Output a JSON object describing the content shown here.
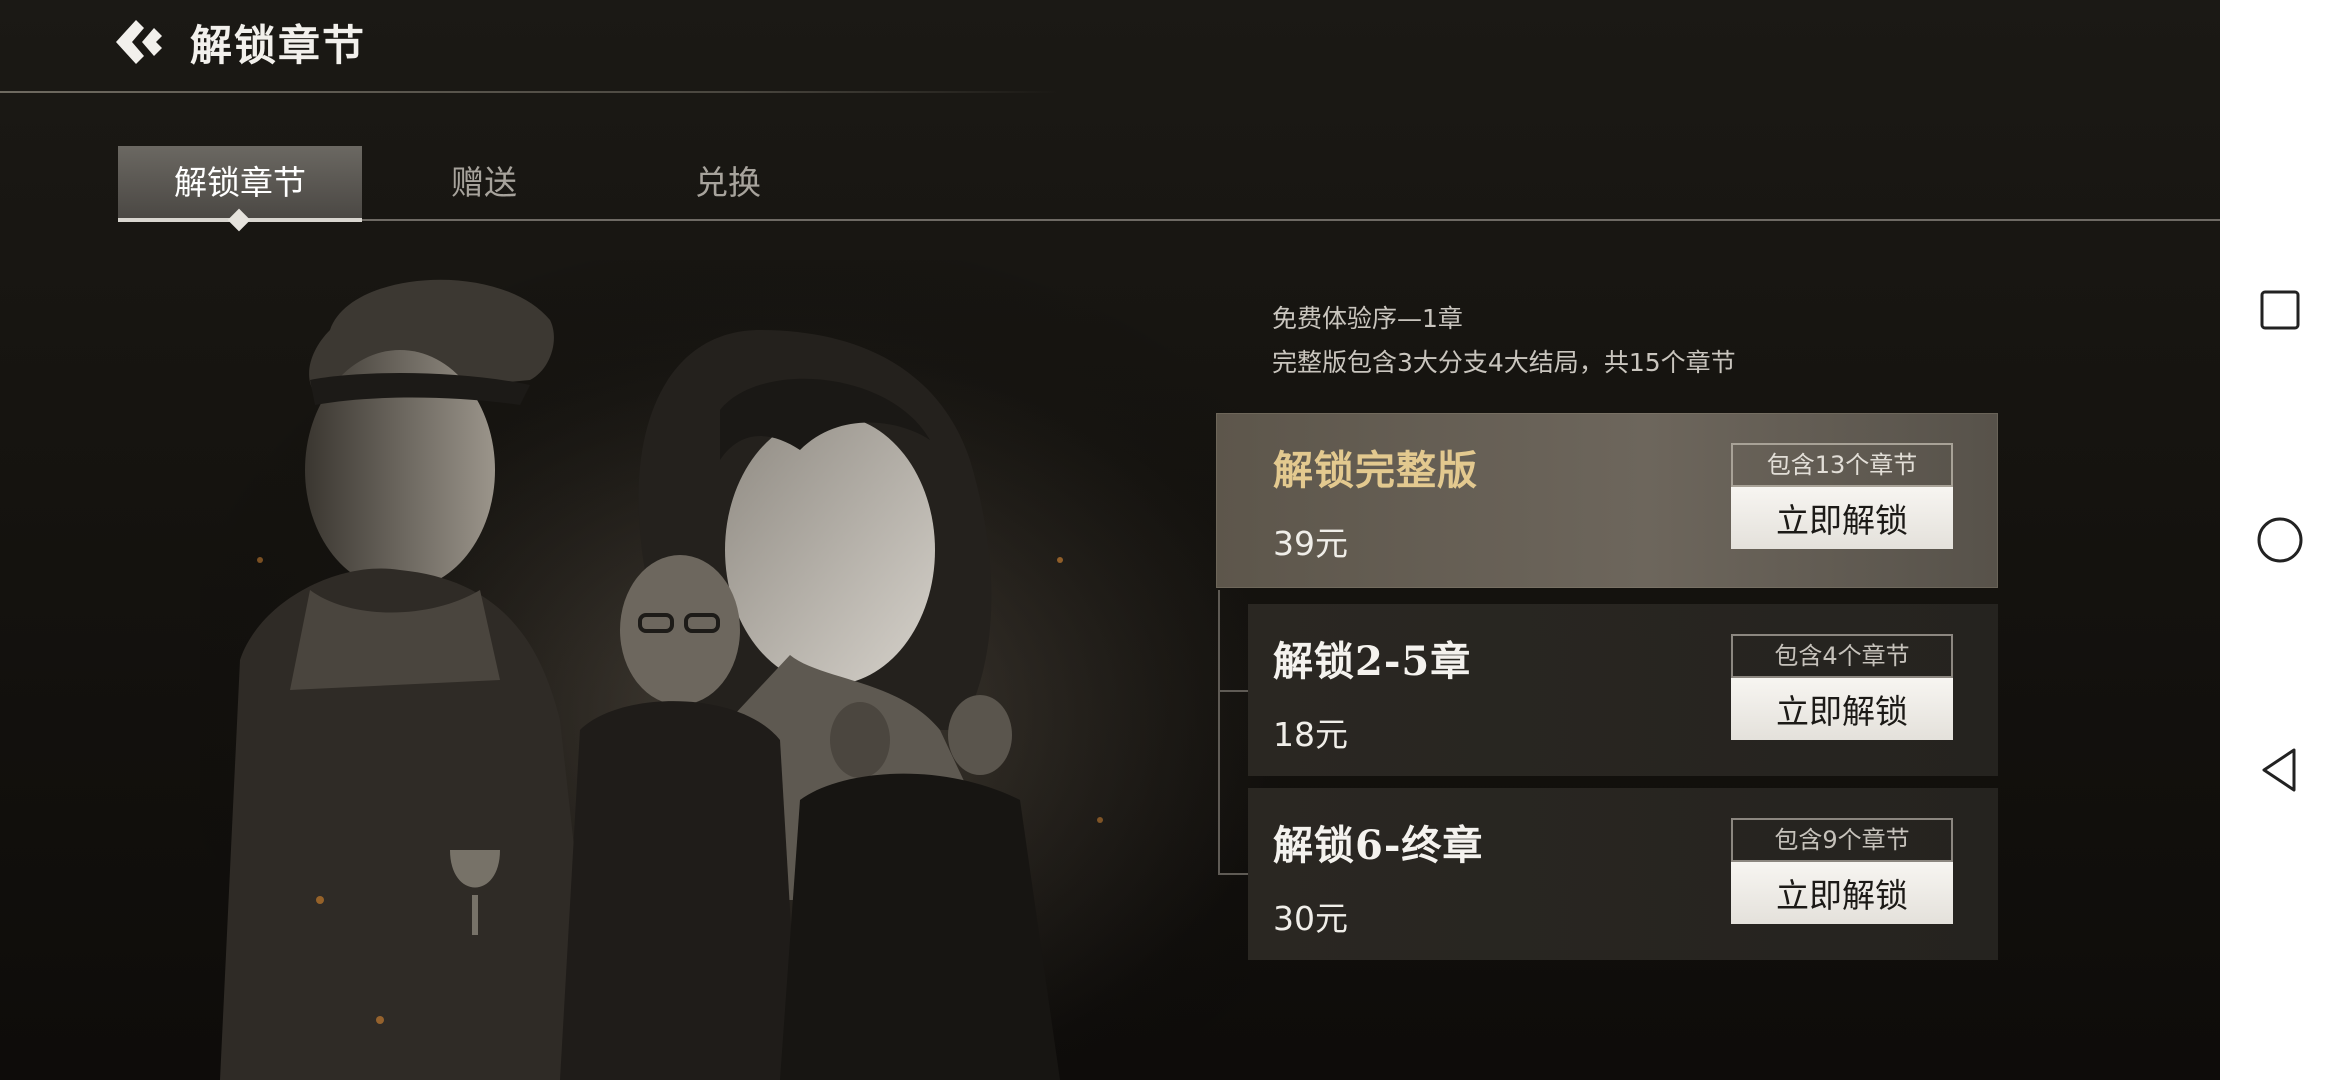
{
  "header": {
    "title": "解锁章节",
    "back_icon": "back-chevron-icon"
  },
  "tabs": [
    {
      "label": "解锁章节",
      "active": true
    },
    {
      "label": "赠送",
      "active": false
    },
    {
      "label": "兑换",
      "active": false
    }
  ],
  "info": {
    "line1": "免费体验序—1章",
    "line2": "完整版包含3大分支4大结局，共15个章节"
  },
  "options": [
    {
      "title": "解锁完整版",
      "price": "39元",
      "badge": "包含13个章节",
      "button": "立即解锁",
      "featured": true
    },
    {
      "title": "解锁2-5章",
      "price": "18元",
      "badge": "包含4个章节",
      "button": "立即解锁",
      "featured": false
    },
    {
      "title": "解锁6-终章",
      "price": "30元",
      "badge": "包含9个章节",
      "button": "立即解锁",
      "featured": false
    }
  ],
  "colors": {
    "background": "#15130f",
    "featured_title": "#e3c98f",
    "button_bg": "#f2f0ec"
  },
  "system_nav": {
    "recent_icon": "square-icon",
    "home_icon": "circle-icon",
    "back_icon": "triangle-back-icon"
  }
}
